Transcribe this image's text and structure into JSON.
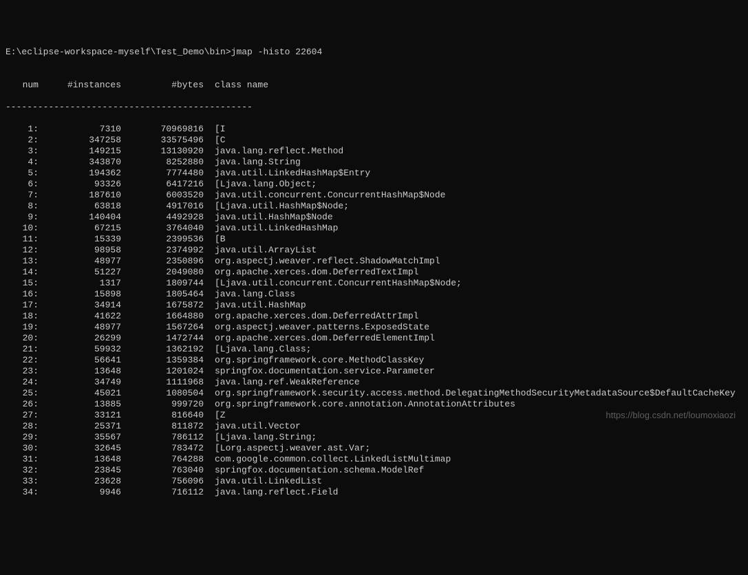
{
  "prompt": "E:\\eclipse-workspace-myself\\Test_Demo\\bin>jmap -histo 22604",
  "blank": "",
  "header": {
    "num": " num",
    "instances": "#instances",
    "bytes": "#bytes",
    "classname": "class name"
  },
  "divider": "----------------------------------------------",
  "rows": [
    {
      "n": "1:",
      "i": "7310",
      "b": "70969816",
      "c": "[I"
    },
    {
      "n": "2:",
      "i": "347258",
      "b": "33575496",
      "c": "[C"
    },
    {
      "n": "3:",
      "i": "149215",
      "b": "13130920",
      "c": "java.lang.reflect.Method"
    },
    {
      "n": "4:",
      "i": "343870",
      "b": "8252880",
      "c": "java.lang.String"
    },
    {
      "n": "5:",
      "i": "194362",
      "b": "7774480",
      "c": "java.util.LinkedHashMap$Entry"
    },
    {
      "n": "6:",
      "i": "93326",
      "b": "6417216",
      "c": "[Ljava.lang.Object;"
    },
    {
      "n": "7:",
      "i": "187610",
      "b": "6003520",
      "c": "java.util.concurrent.ConcurrentHashMap$Node"
    },
    {
      "n": "8:",
      "i": "63818",
      "b": "4917016",
      "c": "[Ljava.util.HashMap$Node;"
    },
    {
      "n": "9:",
      "i": "140404",
      "b": "4492928",
      "c": "java.util.HashMap$Node"
    },
    {
      "n": "10:",
      "i": "67215",
      "b": "3764040",
      "c": "java.util.LinkedHashMap"
    },
    {
      "n": "11:",
      "i": "15339",
      "b": "2399536",
      "c": "[B"
    },
    {
      "n": "12:",
      "i": "98958",
      "b": "2374992",
      "c": "java.util.ArrayList"
    },
    {
      "n": "13:",
      "i": "48977",
      "b": "2350896",
      "c": "org.aspectj.weaver.reflect.ShadowMatchImpl"
    },
    {
      "n": "14:",
      "i": "51227",
      "b": "2049080",
      "c": "org.apache.xerces.dom.DeferredTextImpl"
    },
    {
      "n": "15:",
      "i": "1317",
      "b": "1809744",
      "c": "[Ljava.util.concurrent.ConcurrentHashMap$Node;"
    },
    {
      "n": "16:",
      "i": "15898",
      "b": "1805464",
      "c": "java.lang.Class"
    },
    {
      "n": "17:",
      "i": "34914",
      "b": "1675872",
      "c": "java.util.HashMap"
    },
    {
      "n": "18:",
      "i": "41622",
      "b": "1664880",
      "c": "org.apache.xerces.dom.DeferredAttrImpl"
    },
    {
      "n": "19:",
      "i": "48977",
      "b": "1567264",
      "c": "org.aspectj.weaver.patterns.ExposedState"
    },
    {
      "n": "20:",
      "i": "26299",
      "b": "1472744",
      "c": "org.apache.xerces.dom.DeferredElementImpl"
    },
    {
      "n": "21:",
      "i": "59932",
      "b": "1362192",
      "c": "[Ljava.lang.Class;"
    },
    {
      "n": "22:",
      "i": "56641",
      "b": "1359384",
      "c": "org.springframework.core.MethodClassKey"
    },
    {
      "n": "23:",
      "i": "13648",
      "b": "1201024",
      "c": "springfox.documentation.service.Parameter"
    },
    {
      "n": "24:",
      "i": "34749",
      "b": "1111968",
      "c": "java.lang.ref.WeakReference"
    },
    {
      "n": "25:",
      "i": "45021",
      "b": "1080504",
      "c": "org.springframework.security.access.method.DelegatingMethodSecurityMetadataSource$DefaultCacheKey"
    },
    {
      "n": "26:",
      "i": "13885",
      "b": "999720",
      "c": "org.springframework.core.annotation.AnnotationAttributes"
    },
    {
      "n": "27:",
      "i": "33121",
      "b": "816640",
      "c": "[Z"
    },
    {
      "n": "28:",
      "i": "25371",
      "b": "811872",
      "c": "java.util.Vector"
    },
    {
      "n": "29:",
      "i": "35567",
      "b": "786112",
      "c": "[Ljava.lang.String;"
    },
    {
      "n": "30:",
      "i": "32645",
      "b": "783472",
      "c": "[Lorg.aspectj.weaver.ast.Var;"
    },
    {
      "n": "31:",
      "i": "13648",
      "b": "764288",
      "c": "com.google.common.collect.LinkedListMultimap"
    },
    {
      "n": "32:",
      "i": "23845",
      "b": "763040",
      "c": "springfox.documentation.schema.ModelRef"
    },
    {
      "n": "33:",
      "i": "23628",
      "b": "756096",
      "c": "java.util.LinkedList"
    },
    {
      "n": "34:",
      "i": "9946",
      "b": "716112",
      "c": "java.lang.reflect.Field"
    }
  ],
  "watermark": "https://blog.csdn.net/loumoxiaozi"
}
